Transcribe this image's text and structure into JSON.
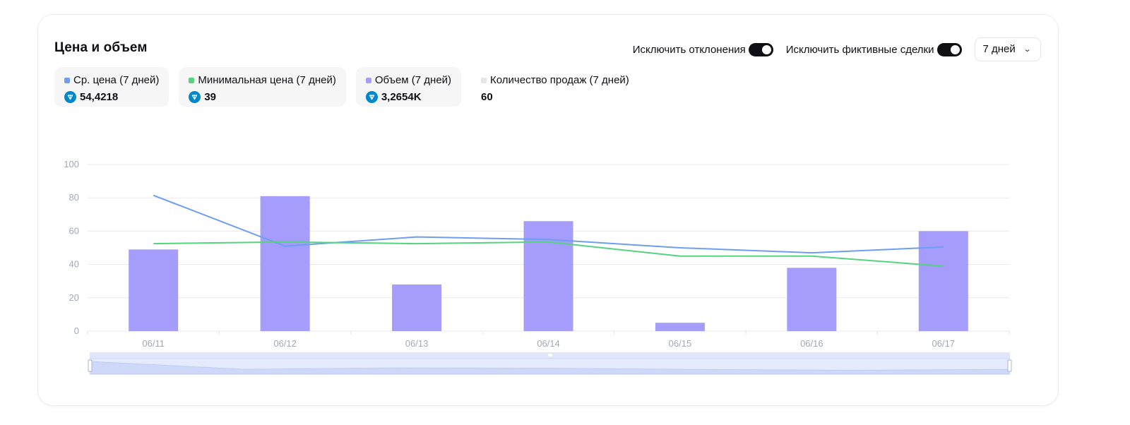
{
  "header": {
    "title": "Цена и объем",
    "exclude_outliers_label": "Исключить отклонения",
    "exclude_fake_label": "Исключить фиктивные сделки",
    "period_value": "7 дней"
  },
  "stats": [
    {
      "label": "Ср. цена (7 дней)",
      "value": "54,4218",
      "color": "#6e9ef2",
      "currency_icon": "ton-icon"
    },
    {
      "label": "Минимальная цена (7 дней)",
      "value": "39",
      "color": "#55d37d",
      "currency_icon": "ton-icon"
    },
    {
      "label": "Объем (7 дней)",
      "value": "3,2654K",
      "color": "#a59cfc",
      "currency_icon": "ton-icon"
    },
    {
      "label": "Количество продаж (7 дней)",
      "value": "60",
      "color": "#e6e6e6"
    }
  ],
  "chart_data": {
    "type": "bar",
    "categories": [
      "06/11",
      "06/12",
      "06/13",
      "06/14",
      "06/15",
      "06/16",
      "06/17"
    ],
    "ylim": [
      0,
      100
    ],
    "yticks": [
      0,
      20,
      40,
      60,
      80,
      100
    ],
    "grid": true,
    "series": [
      {
        "name": "Объем (7 дней)",
        "type": "bar",
        "color": "#a59cfc",
        "values": [
          49,
          81,
          28,
          66,
          5,
          38,
          60
        ]
      },
      {
        "name": "Ср. цена (7 дней)",
        "type": "line",
        "color": "#6e9ef2",
        "values": [
          81.5,
          51,
          56.5,
          55,
          50,
          47,
          50.5
        ]
      },
      {
        "name": "Минимальная цена (7 дней)",
        "type": "line",
        "color": "#55d37d",
        "values": [
          52.5,
          53.5,
          52.5,
          53.5,
          45,
          45,
          39
        ]
      }
    ]
  }
}
